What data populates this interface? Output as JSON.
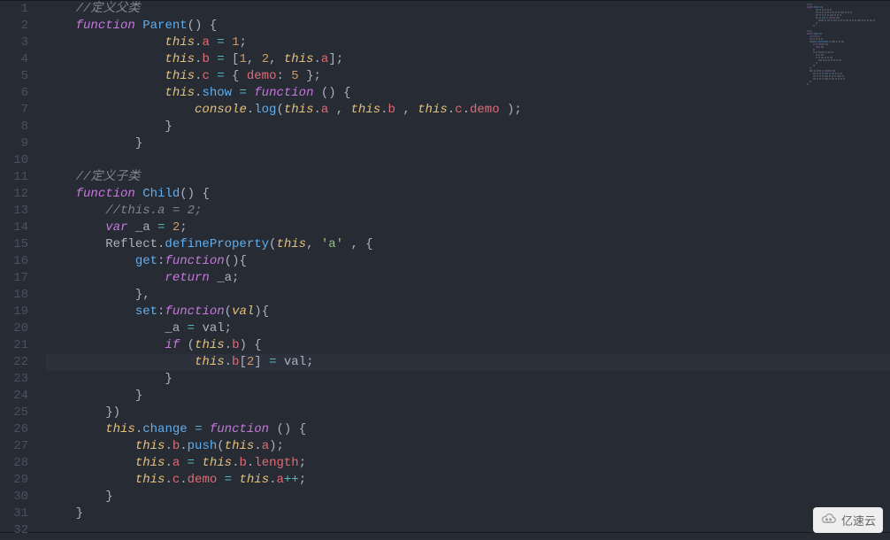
{
  "editor": {
    "highlighted_line": 22,
    "lines": [
      {
        "n": 1,
        "tokens": [
          {
            "t": "    ",
            "c": "pn"
          },
          {
            "t": "//定义父类",
            "c": "cmt"
          }
        ]
      },
      {
        "n": 2,
        "tokens": [
          {
            "t": "    ",
            "c": "pn"
          },
          {
            "t": "function",
            "c": "kw"
          },
          {
            "t": " ",
            "c": "pn"
          },
          {
            "t": "Parent",
            "c": "func"
          },
          {
            "t": "() {",
            "c": "pn"
          }
        ]
      },
      {
        "n": 3,
        "tokens": [
          {
            "t": "                ",
            "c": "pn"
          },
          {
            "t": "this",
            "c": "this"
          },
          {
            "t": ".",
            "c": "pn"
          },
          {
            "t": "a",
            "c": "prop"
          },
          {
            "t": " ",
            "c": "pn"
          },
          {
            "t": "=",
            "c": "op"
          },
          {
            "t": " ",
            "c": "pn"
          },
          {
            "t": "1",
            "c": "num"
          },
          {
            "t": ";",
            "c": "pn"
          }
        ]
      },
      {
        "n": 4,
        "tokens": [
          {
            "t": "                ",
            "c": "pn"
          },
          {
            "t": "this",
            "c": "this"
          },
          {
            "t": ".",
            "c": "pn"
          },
          {
            "t": "b",
            "c": "prop"
          },
          {
            "t": " ",
            "c": "pn"
          },
          {
            "t": "=",
            "c": "op"
          },
          {
            "t": " [",
            "c": "pn"
          },
          {
            "t": "1",
            "c": "num"
          },
          {
            "t": ", ",
            "c": "pn"
          },
          {
            "t": "2",
            "c": "num"
          },
          {
            "t": ", ",
            "c": "pn"
          },
          {
            "t": "this",
            "c": "this"
          },
          {
            "t": ".",
            "c": "pn"
          },
          {
            "t": "a",
            "c": "prop"
          },
          {
            "t": "];",
            "c": "pn"
          }
        ]
      },
      {
        "n": 5,
        "tokens": [
          {
            "t": "                ",
            "c": "pn"
          },
          {
            "t": "this",
            "c": "this"
          },
          {
            "t": ".",
            "c": "pn"
          },
          {
            "t": "c",
            "c": "prop"
          },
          {
            "t": " ",
            "c": "pn"
          },
          {
            "t": "=",
            "c": "op"
          },
          {
            "t": " { ",
            "c": "pn"
          },
          {
            "t": "demo",
            "c": "prop"
          },
          {
            "t": ": ",
            "c": "pn"
          },
          {
            "t": "5",
            "c": "num"
          },
          {
            "t": " };",
            "c": "pn"
          }
        ]
      },
      {
        "n": 6,
        "tokens": [
          {
            "t": "                ",
            "c": "pn"
          },
          {
            "t": "this",
            "c": "this"
          },
          {
            "t": ".",
            "c": "pn"
          },
          {
            "t": "show",
            "c": "func"
          },
          {
            "t": " ",
            "c": "pn"
          },
          {
            "t": "=",
            "c": "op"
          },
          {
            "t": " ",
            "c": "pn"
          },
          {
            "t": "function",
            "c": "kw"
          },
          {
            "t": " () {",
            "c": "pn"
          }
        ]
      },
      {
        "n": 7,
        "tokens": [
          {
            "t": "                    ",
            "c": "pn"
          },
          {
            "t": "console",
            "c": "this"
          },
          {
            "t": ".",
            "c": "pn"
          },
          {
            "t": "log",
            "c": "func"
          },
          {
            "t": "(",
            "c": "pn"
          },
          {
            "t": "this",
            "c": "this"
          },
          {
            "t": ".",
            "c": "pn"
          },
          {
            "t": "a",
            "c": "prop"
          },
          {
            "t": " , ",
            "c": "pn"
          },
          {
            "t": "this",
            "c": "this"
          },
          {
            "t": ".",
            "c": "pn"
          },
          {
            "t": "b",
            "c": "prop"
          },
          {
            "t": " , ",
            "c": "pn"
          },
          {
            "t": "this",
            "c": "this"
          },
          {
            "t": ".",
            "c": "pn"
          },
          {
            "t": "c",
            "c": "prop"
          },
          {
            "t": ".",
            "c": "pn"
          },
          {
            "t": "demo",
            "c": "prop"
          },
          {
            "t": " );",
            "c": "pn"
          }
        ]
      },
      {
        "n": 8,
        "tokens": [
          {
            "t": "                }",
            "c": "pn"
          }
        ]
      },
      {
        "n": 9,
        "tokens": [
          {
            "t": "            }",
            "c": "pn"
          }
        ]
      },
      {
        "n": 10,
        "tokens": []
      },
      {
        "n": 11,
        "tokens": [
          {
            "t": "    ",
            "c": "pn"
          },
          {
            "t": "//定义子类",
            "c": "cmt"
          }
        ]
      },
      {
        "n": 12,
        "tokens": [
          {
            "t": "    ",
            "c": "pn"
          },
          {
            "t": "function",
            "c": "kw"
          },
          {
            "t": " ",
            "c": "pn"
          },
          {
            "t": "Child",
            "c": "func"
          },
          {
            "t": "() {",
            "c": "pn"
          }
        ]
      },
      {
        "n": 13,
        "tokens": [
          {
            "t": "        ",
            "c": "pn"
          },
          {
            "t": "//this.a = 2;",
            "c": "cmt"
          }
        ]
      },
      {
        "n": 14,
        "tokens": [
          {
            "t": "        ",
            "c": "pn"
          },
          {
            "t": "var",
            "c": "kw"
          },
          {
            "t": " _a ",
            "c": "var"
          },
          {
            "t": "=",
            "c": "op"
          },
          {
            "t": " ",
            "c": "pn"
          },
          {
            "t": "2",
            "c": "num"
          },
          {
            "t": ";",
            "c": "pn"
          }
        ]
      },
      {
        "n": 15,
        "tokens": [
          {
            "t": "        Reflect.",
            "c": "var"
          },
          {
            "t": "defineProperty",
            "c": "func"
          },
          {
            "t": "(",
            "c": "pn"
          },
          {
            "t": "this",
            "c": "this"
          },
          {
            "t": ", ",
            "c": "pn"
          },
          {
            "t": "'a'",
            "c": "str"
          },
          {
            "t": " , {",
            "c": "pn"
          }
        ]
      },
      {
        "n": 16,
        "tokens": [
          {
            "t": "            ",
            "c": "pn"
          },
          {
            "t": "get",
            "c": "func"
          },
          {
            "t": ":",
            "c": "pn"
          },
          {
            "t": "function",
            "c": "kw"
          },
          {
            "t": "(){",
            "c": "pn"
          }
        ]
      },
      {
        "n": 17,
        "tokens": [
          {
            "t": "                ",
            "c": "pn"
          },
          {
            "t": "return",
            "c": "kw"
          },
          {
            "t": " _a;",
            "c": "var"
          }
        ]
      },
      {
        "n": 18,
        "tokens": [
          {
            "t": "            },",
            "c": "pn"
          }
        ]
      },
      {
        "n": 19,
        "tokens": [
          {
            "t": "            ",
            "c": "pn"
          },
          {
            "t": "set",
            "c": "func"
          },
          {
            "t": ":",
            "c": "pn"
          },
          {
            "t": "function",
            "c": "kw"
          },
          {
            "t": "(",
            "c": "pn"
          },
          {
            "t": "val",
            "c": "param"
          },
          {
            "t": "){",
            "c": "pn"
          }
        ]
      },
      {
        "n": 20,
        "tokens": [
          {
            "t": "                _a ",
            "c": "var"
          },
          {
            "t": "=",
            "c": "op"
          },
          {
            "t": " val;",
            "c": "var"
          }
        ]
      },
      {
        "n": 21,
        "tokens": [
          {
            "t": "                ",
            "c": "pn"
          },
          {
            "t": "if",
            "c": "kw"
          },
          {
            "t": " (",
            "c": "pn"
          },
          {
            "t": "this",
            "c": "this"
          },
          {
            "t": ".",
            "c": "pn"
          },
          {
            "t": "b",
            "c": "prop"
          },
          {
            "t": ") {",
            "c": "pn"
          }
        ]
      },
      {
        "n": 22,
        "tokens": [
          {
            "t": "                    ",
            "c": "pn"
          },
          {
            "t": "this",
            "c": "this"
          },
          {
            "t": ".",
            "c": "pn"
          },
          {
            "t": "b",
            "c": "prop"
          },
          {
            "t": "[",
            "c": "pn"
          },
          {
            "t": "2",
            "c": "num"
          },
          {
            "t": "] ",
            "c": "pn"
          },
          {
            "t": "=",
            "c": "op"
          },
          {
            "t": " val;",
            "c": "var"
          }
        ]
      },
      {
        "n": 23,
        "tokens": [
          {
            "t": "                }",
            "c": "pn"
          }
        ]
      },
      {
        "n": 24,
        "tokens": [
          {
            "t": "            }",
            "c": "pn"
          }
        ]
      },
      {
        "n": 25,
        "tokens": [
          {
            "t": "        })",
            "c": "pn"
          }
        ]
      },
      {
        "n": 26,
        "tokens": [
          {
            "t": "        ",
            "c": "pn"
          },
          {
            "t": "this",
            "c": "this"
          },
          {
            "t": ".",
            "c": "pn"
          },
          {
            "t": "change",
            "c": "func"
          },
          {
            "t": " ",
            "c": "pn"
          },
          {
            "t": "=",
            "c": "op"
          },
          {
            "t": " ",
            "c": "pn"
          },
          {
            "t": "function",
            "c": "kw"
          },
          {
            "t": " () {",
            "c": "pn"
          }
        ]
      },
      {
        "n": 27,
        "tokens": [
          {
            "t": "            ",
            "c": "pn"
          },
          {
            "t": "this",
            "c": "this"
          },
          {
            "t": ".",
            "c": "pn"
          },
          {
            "t": "b",
            "c": "prop"
          },
          {
            "t": ".",
            "c": "pn"
          },
          {
            "t": "push",
            "c": "func"
          },
          {
            "t": "(",
            "c": "pn"
          },
          {
            "t": "this",
            "c": "this"
          },
          {
            "t": ".",
            "c": "pn"
          },
          {
            "t": "a",
            "c": "prop"
          },
          {
            "t": ");",
            "c": "pn"
          }
        ]
      },
      {
        "n": 28,
        "tokens": [
          {
            "t": "            ",
            "c": "pn"
          },
          {
            "t": "this",
            "c": "this"
          },
          {
            "t": ".",
            "c": "pn"
          },
          {
            "t": "a",
            "c": "prop"
          },
          {
            "t": " ",
            "c": "pn"
          },
          {
            "t": "=",
            "c": "op"
          },
          {
            "t": " ",
            "c": "pn"
          },
          {
            "t": "this",
            "c": "this"
          },
          {
            "t": ".",
            "c": "pn"
          },
          {
            "t": "b",
            "c": "prop"
          },
          {
            "t": ".",
            "c": "pn"
          },
          {
            "t": "length",
            "c": "prop"
          },
          {
            "t": ";",
            "c": "pn"
          }
        ]
      },
      {
        "n": 29,
        "tokens": [
          {
            "t": "            ",
            "c": "pn"
          },
          {
            "t": "this",
            "c": "this"
          },
          {
            "t": ".",
            "c": "pn"
          },
          {
            "t": "c",
            "c": "prop"
          },
          {
            "t": ".",
            "c": "pn"
          },
          {
            "t": "demo",
            "c": "prop"
          },
          {
            "t": " ",
            "c": "pn"
          },
          {
            "t": "=",
            "c": "op"
          },
          {
            "t": " ",
            "c": "pn"
          },
          {
            "t": "this",
            "c": "this"
          },
          {
            "t": ".",
            "c": "pn"
          },
          {
            "t": "a",
            "c": "prop"
          },
          {
            "t": "++",
            "c": "op"
          },
          {
            "t": ";",
            "c": "pn"
          }
        ]
      },
      {
        "n": 30,
        "tokens": [
          {
            "t": "        }",
            "c": "pn"
          }
        ]
      },
      {
        "n": 31,
        "tokens": [
          {
            "t": "    }",
            "c": "pn"
          }
        ]
      },
      {
        "n": 32,
        "tokens": []
      }
    ]
  },
  "overlay": {
    "label": "亿速云"
  }
}
